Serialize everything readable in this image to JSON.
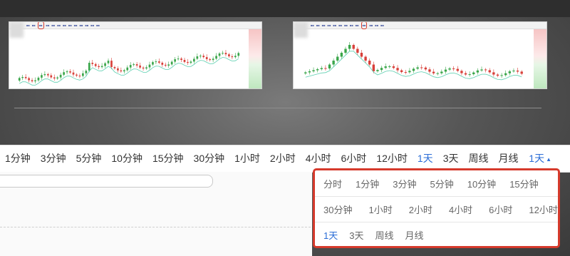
{
  "toolbar": {
    "tabs": [
      "1分钟",
      "3分钟",
      "5分钟",
      "10分钟",
      "15分钟",
      "30分钟",
      "1小时",
      "2小时",
      "4小时",
      "6小时",
      "12小时",
      "1天",
      "3天",
      "周线",
      "月线"
    ],
    "active_index": 11,
    "selected": "1天",
    "caret_icon": "caret-up-icon"
  },
  "period_panel": {
    "rows": [
      [
        "分时",
        "1分钟",
        "3分钟",
        "5分钟",
        "10分钟",
        "15分钟"
      ],
      [
        "30分钟",
        "1小时",
        "2小时",
        "4小时",
        "6小时",
        "12小时"
      ],
      [
        "1天",
        "3天",
        "周线",
        "月线"
      ]
    ],
    "active": "1天",
    "border_color": "#d63a2c"
  },
  "colors": {
    "accent": "#2a6cd6",
    "up": "#3aa64a",
    "down": "#d8403a"
  }
}
